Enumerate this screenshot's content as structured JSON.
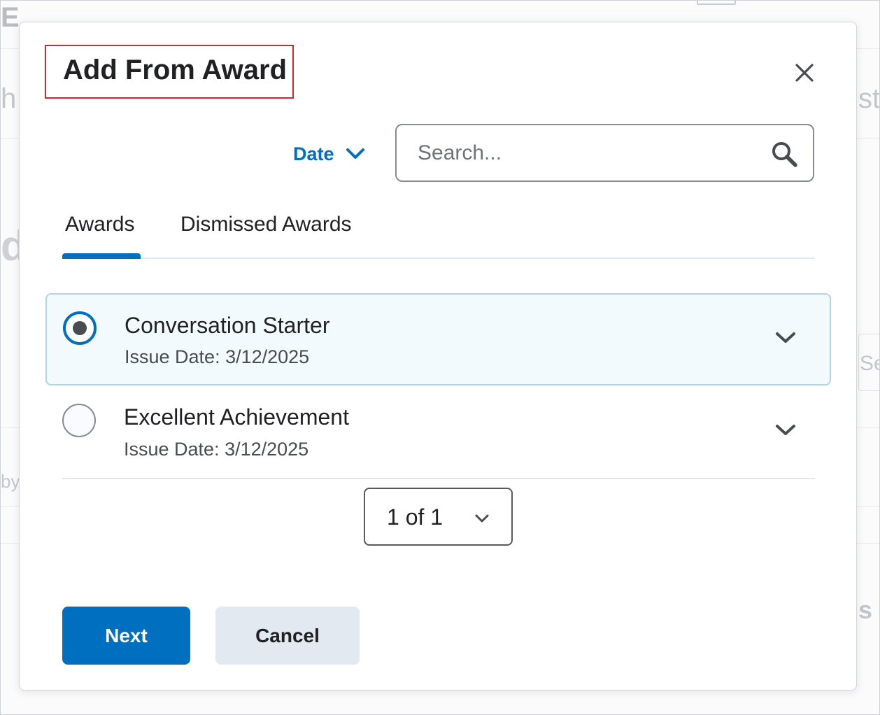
{
  "dialog": {
    "title": "Add From Award",
    "close_icon": "close-icon"
  },
  "toolbar": {
    "sort_label": "Date",
    "sort_icon": "chevron-down-icon",
    "search_placeholder": "Search...",
    "search_value": "",
    "search_icon": "search-icon"
  },
  "tabs": [
    {
      "label": "Awards",
      "selected": true
    },
    {
      "label": "Dismissed Awards",
      "selected": false
    }
  ],
  "awards": [
    {
      "name": "Conversation Starter",
      "issue_date": "Issue Date: 3/12/2025",
      "selected": true
    },
    {
      "name": "Excellent Achievement",
      "issue_date": "Issue Date: 3/12/2025",
      "selected": false
    }
  ],
  "pagination": {
    "label": "1 of 1"
  },
  "actions": {
    "next_label": "Next",
    "cancel_label": "Cancel"
  },
  "colors": {
    "accent": "#006fbf",
    "title_outline": "#d22630",
    "selected_row_bg": "#f2fafe"
  }
}
